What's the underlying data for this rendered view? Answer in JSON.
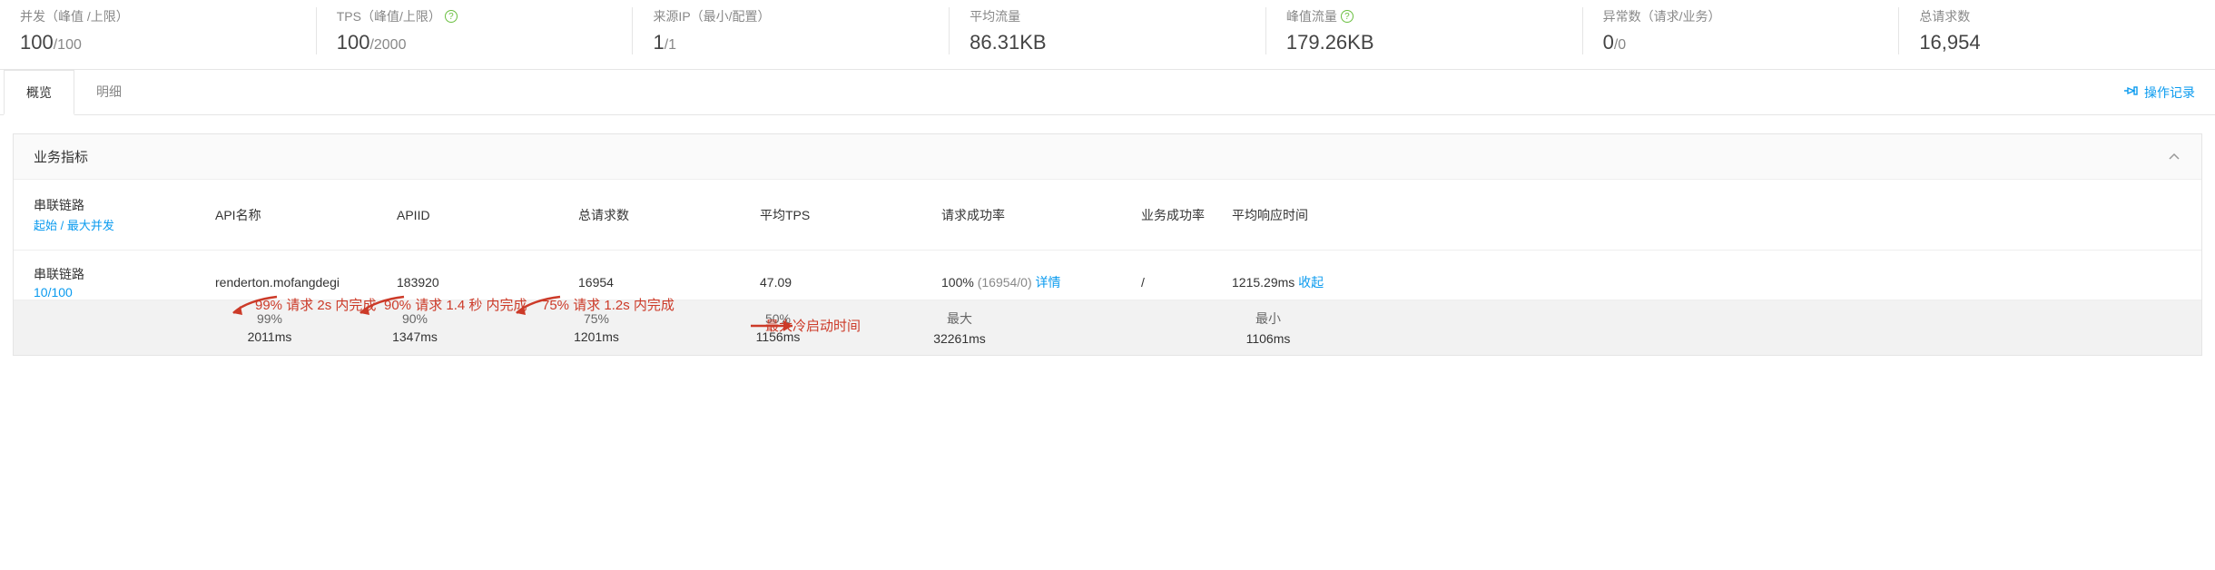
{
  "metrics": {
    "concurrency": {
      "label": "并发（峰值 /上限）",
      "value": "100",
      "sub": "/100"
    },
    "tps": {
      "label": "TPS（峰值/上限）",
      "value": "100",
      "sub": "/2000",
      "help": true
    },
    "source_ip": {
      "label": "来源IP（最小/配置）",
      "value": "1",
      "sub": "/1"
    },
    "avg_flow": {
      "label": "平均流量",
      "value": "86.31KB"
    },
    "peak_flow": {
      "label": "峰值流量",
      "value": "179.26KB",
      "help": true
    },
    "errors": {
      "label": "异常数（请求/业务）",
      "value": "0",
      "sub": "/0"
    },
    "total_req": {
      "label": "总请求数",
      "value": "16,954"
    }
  },
  "tabs": {
    "overview": "概览",
    "detail": "明细"
  },
  "op_log": "操作记录",
  "panel": {
    "title": "业务指标"
  },
  "thead": {
    "lianlu": "串联链路",
    "lianlu_sub": "起始 / 最大并发",
    "api_name": "API名称",
    "api_id": "APIID",
    "total_req": "总请求数",
    "avg_tps": "平均TPS",
    "success_rate": "请求成功率",
    "biz_success": "业务成功率",
    "avg_rt": "平均响应时间"
  },
  "row": {
    "lianlu": "串联链路",
    "lianlu_val": "10/100",
    "api_name": "renderton.mofangdegi",
    "api_id": "183920",
    "total_req": "16954",
    "avg_tps": "47.09",
    "success_rate": "100%",
    "success_detail": "(16954/0)",
    "detail_link": "详情",
    "biz_success": "/",
    "avg_rt": "1215.29ms",
    "collapse": "收起"
  },
  "subrow": {
    "p99": {
      "label": "99%",
      "value": "2011ms"
    },
    "p90": {
      "label": "90%",
      "value": "1347ms"
    },
    "p75": {
      "label": "75%",
      "value": "1201ms"
    },
    "p50": {
      "label": "50%",
      "value": "1156ms"
    },
    "max": {
      "label": "最大",
      "value": "32261ms"
    },
    "min": {
      "label": "最小",
      "value": "1106ms"
    }
  },
  "annotations": {
    "p99": "99% 请求 2s 内完成",
    "p90": "90% 请求 1.4 秒 内完成",
    "p75": "75% 请求 1.2s 内完成",
    "cold_start": "最大冷启动时间"
  }
}
